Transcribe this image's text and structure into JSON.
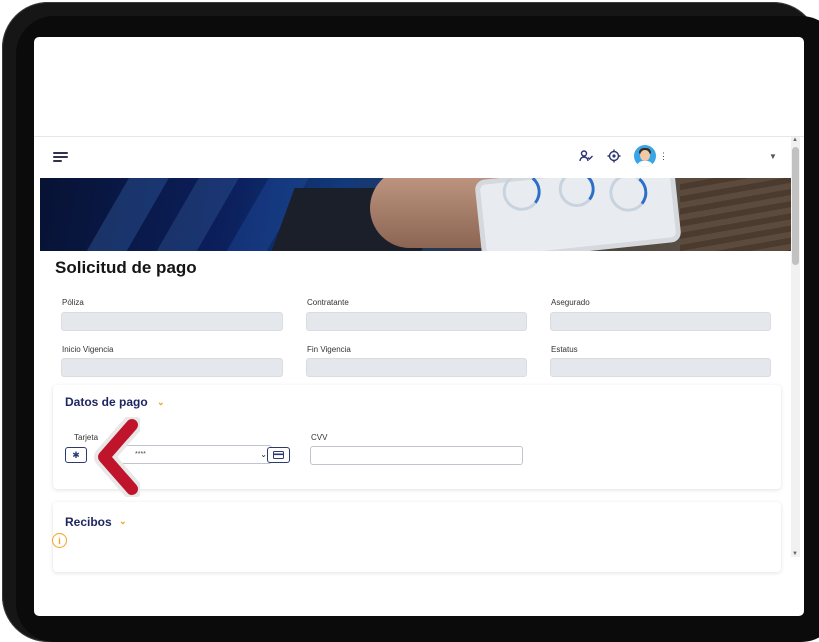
{
  "header": {
    "menu_icon": "hamburger-menu-icon",
    "actions": [
      "user-check-icon",
      "settings-target-icon",
      "avatar"
    ],
    "more_icon": "more-vertical-icon",
    "dropdown_icon": "caret-down-icon"
  },
  "page": {
    "title": "Solicitud de pago"
  },
  "policy_fields": [
    {
      "label": "Póliza",
      "value": ""
    },
    {
      "label": "Contratante",
      "value": ""
    },
    {
      "label": "Asegurado",
      "value": ""
    },
    {
      "label": "Inicio Vigencia",
      "value": ""
    },
    {
      "label": "Fin Vigencia",
      "value": ""
    },
    {
      "label": "Estatus",
      "value": ""
    }
  ],
  "payment": {
    "section_title": "Datos de pago",
    "card_label": "Tarjeta",
    "card_value": "****",
    "cvv_label": "CVV",
    "cvv_value": ""
  },
  "receipts": {
    "section_title": "Recibos"
  },
  "colors": {
    "accent_orange": "#f3a11b",
    "navy": "#1d2660",
    "marker_red": "#c0142c",
    "field_bg": "#e4e8ec"
  }
}
